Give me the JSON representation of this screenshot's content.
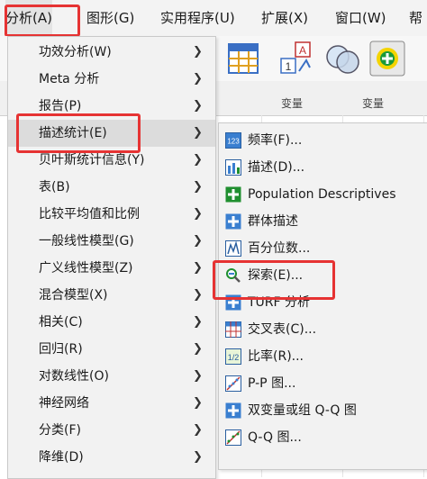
{
  "menubar": [
    {
      "label": "分析(A)"
    },
    {
      "label": "图形(G)"
    },
    {
      "label": "实用程序(U)"
    },
    {
      "label": "扩展(X)"
    },
    {
      "label": "窗口(W)"
    },
    {
      "label": "帮"
    }
  ],
  "sheet": {
    "col_label_1": "变量",
    "col_label_2": "变量"
  },
  "analyze_menu": [
    {
      "label": "功效分析(W)"
    },
    {
      "label": "Meta 分析"
    },
    {
      "label": "报告(P)"
    },
    {
      "label": "描述统计(E)"
    },
    {
      "label": "贝叶斯统计信息(Y)"
    },
    {
      "label": "表(B)"
    },
    {
      "label": "比较平均值和比例"
    },
    {
      "label": "一般线性模型(G)"
    },
    {
      "label": "广义线性模型(Z)"
    },
    {
      "label": "混合模型(X)"
    },
    {
      "label": "相关(C)"
    },
    {
      "label": "回归(R)"
    },
    {
      "label": "对数线性(O)"
    },
    {
      "label": "神经网络"
    },
    {
      "label": "分类(F)"
    },
    {
      "label": "降维(D)"
    }
  ],
  "descriptives_menu": [
    {
      "label": "频率(F)...",
      "icon": "frequencies-icon"
    },
    {
      "label": "描述(D)...",
      "icon": "descriptives-icon"
    },
    {
      "label": "Population Descriptives",
      "icon": "plus-icon"
    },
    {
      "label": "群体描述",
      "icon": "plus-icon"
    },
    {
      "label": "百分位数...",
      "icon": "percentiles-icon"
    },
    {
      "label": "探索(E)...",
      "icon": "explore-icon"
    },
    {
      "label": "TURF 分析",
      "icon": "plus-icon"
    },
    {
      "label": "交叉表(C)...",
      "icon": "crosstabs-icon"
    },
    {
      "label": "比率(R)...",
      "icon": "ratio-icon"
    },
    {
      "label": "P-P 图...",
      "icon": "pp-plot-icon"
    },
    {
      "label": "双变量或组 Q-Q 图",
      "icon": "plus-icon"
    },
    {
      "label": "Q-Q 图...",
      "icon": "qq-plot-icon"
    }
  ],
  "colors": {
    "highlight": "#e63333",
    "plus_green": "#1f8f2f",
    "plus_blue": "#3a7fd0"
  }
}
